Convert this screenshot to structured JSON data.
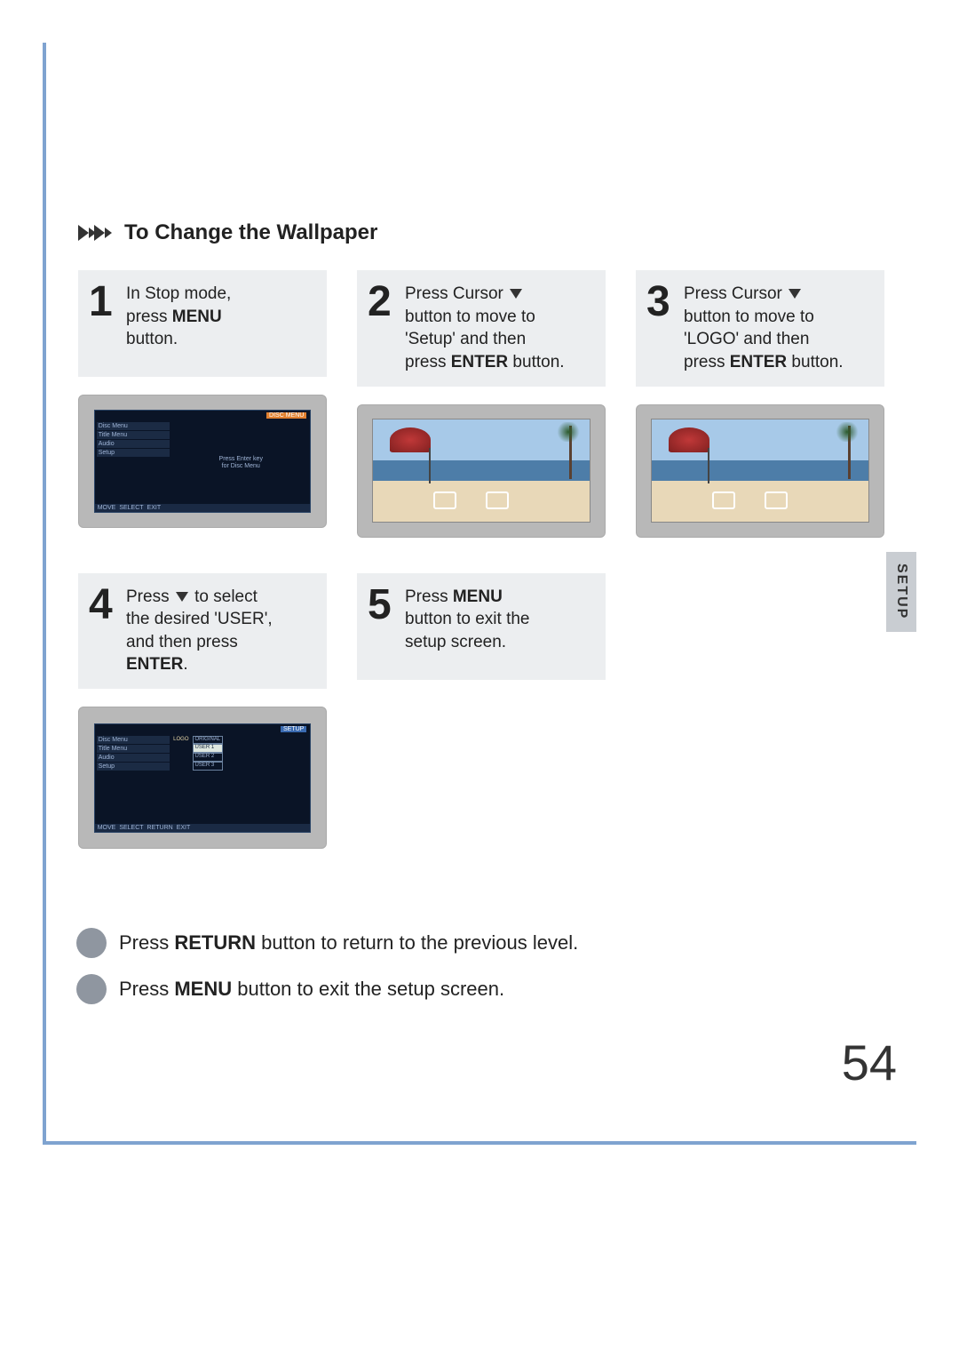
{
  "section_title": "To Change the Wallpaper",
  "side_tab": "SETUP",
  "page_number": "54",
  "steps": [
    {
      "num": "1",
      "line1": "In Stop mode,",
      "line2a": "press ",
      "line2b": "MENU",
      "line3": "button.",
      "screen": {
        "tag": "DISC MENU",
        "side": [
          "Disc Menu",
          "Title Menu",
          "Audio",
          "Setup"
        ],
        "main1": "Press Enter key",
        "main2": "for Disc Menu",
        "foot": [
          "MOVE",
          "SELECT",
          "EXIT"
        ]
      }
    },
    {
      "num": "2",
      "line1a": "Press Cursor ",
      "line2": "button to move to",
      "line3": "'Setup' and then",
      "line4a": "press ",
      "line4b": "ENTER",
      "line4c": " button."
    },
    {
      "num": "3",
      "line1a": "Press Cursor ",
      "line2": "button to move to",
      "line3": "'LOGO' and then",
      "line4a": "press ",
      "line4b": "ENTER",
      "line4c": " button."
    },
    {
      "num": "4",
      "line1a": "Press ",
      "line1b": " to select",
      "line2": "the desired 'USER',",
      "line3": "and then press",
      "line4b": "ENTER",
      "line4c": ".",
      "screen": {
        "tag": "SETUP",
        "side": [
          "Disc Menu",
          "Title Menu",
          "Audio",
          "Setup"
        ],
        "col2": "LOGO",
        "opts": [
          "ORIGINAL",
          "USER 1",
          "USER 2",
          "USER 3"
        ],
        "foot": [
          "MOVE",
          "SELECT",
          "RETURN",
          "EXIT"
        ]
      }
    },
    {
      "num": "5",
      "line1a": "Press ",
      "line1b": "MENU",
      "line2": "button to exit the",
      "line3": "setup screen."
    }
  ],
  "notes": {
    "n1a": "Press ",
    "n1b": "RETURN",
    "n1c": " button to return to the previous level.",
    "n2a": "Press ",
    "n2b": "MENU",
    "n2c": " button to exit the setup screen."
  }
}
